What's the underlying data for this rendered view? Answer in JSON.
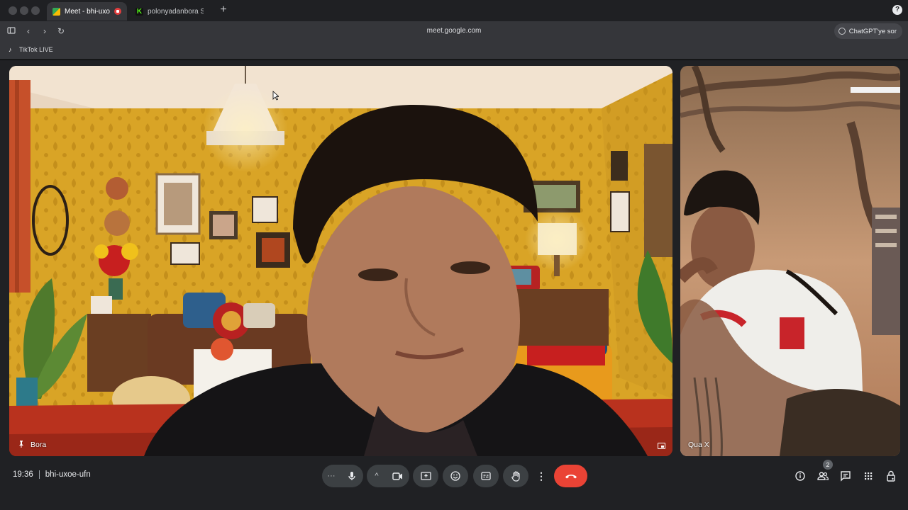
{
  "browser": {
    "tabs": [
      {
        "title": "Meet - bhi-uxoe-",
        "active": true,
        "recording": true
      },
      {
        "title": "polonyadanbora Stre",
        "active": false
      }
    ],
    "url": "meet.google.com",
    "extension_label": "ChatGPT'ye sor",
    "bookmark": "TikTok LIVE"
  },
  "meeting": {
    "time": "19:36",
    "code": "bhi-uxoe-ufn",
    "participants_count": "2"
  },
  "participants": [
    {
      "name": "Bora",
      "pinned": true
    },
    {
      "name": "Qua X",
      "pinned": false
    }
  ],
  "icons": {
    "mic": "microphone-icon",
    "camera": "camera-icon",
    "present": "present-screen-icon",
    "emoji": "emoji-icon",
    "captions": "captions-icon",
    "hand": "raise-hand-icon",
    "hangup": "hangup-icon"
  },
  "colors": {
    "hangup": "#ea4335",
    "control_bg": "#3c4043",
    "stage_bg": "#202124"
  }
}
